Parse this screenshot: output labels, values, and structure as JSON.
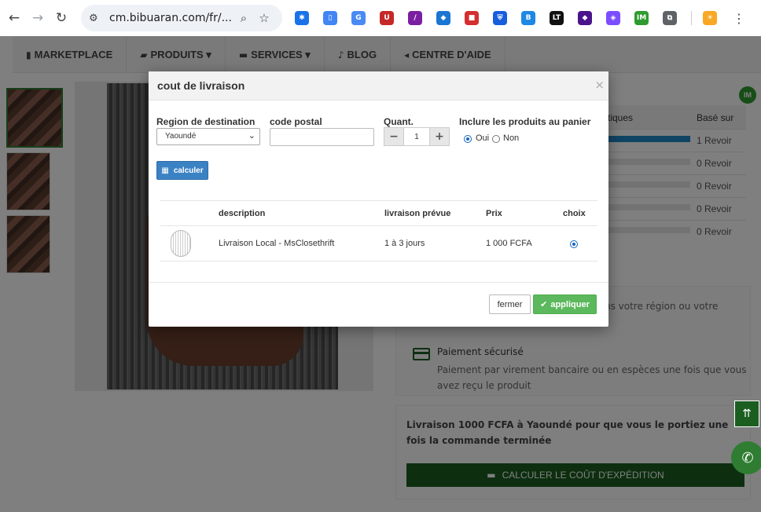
{
  "browser": {
    "url": "cm.bibuaran.com/fr/...",
    "back_icon": "←",
    "forward_icon": "→",
    "reload_icon": "↻",
    "tune_icon": "⚙",
    "zoom_icon": "⌕",
    "star_icon": "☆",
    "kebab_icon": "⋮",
    "extensions": [
      {
        "name": "ext-snowflake-icon",
        "color": "#1a73e8",
        "glyph": "✱"
      },
      {
        "name": "ext-doc-icon",
        "color": "#4285f4",
        "glyph": "▯"
      },
      {
        "name": "ext-translate-icon",
        "color": "#4a8af4",
        "glyph": "G"
      },
      {
        "name": "ext-ublock-icon",
        "color": "#c62828",
        "glyph": "U"
      },
      {
        "name": "ext-feather-icon",
        "color": "#7b1fa2",
        "glyph": "/"
      },
      {
        "name": "ext-tag-icon",
        "color": "#1976d2",
        "glyph": "◆"
      },
      {
        "name": "ext-gift-icon",
        "color": "#d32f2f",
        "glyph": "■"
      },
      {
        "name": "ext-bitwarden-icon",
        "color": "#175ddc",
        "glyph": "⛨"
      },
      {
        "name": "ext-b-icon",
        "color": "#1e88e5",
        "glyph": "B"
      },
      {
        "name": "ext-lt-icon",
        "color": "#111111",
        "glyph": "LT"
      },
      {
        "name": "ext-diamond-icon",
        "color": "#4a148c",
        "glyph": "◆"
      },
      {
        "name": "ext-puzzle-color-icon",
        "color": "#7c4dff",
        "glyph": "◈"
      },
      {
        "name": "ext-im-icon",
        "color": "#2e9b2e",
        "glyph": "IM"
      },
      {
        "name": "extensions-puzzle-icon",
        "color": "#5f6368",
        "glyph": "⧉"
      },
      {
        "name": "ext-sun-icon",
        "color": "#f9a825",
        "glyph": "☀"
      }
    ]
  },
  "nav": {
    "items": [
      {
        "icon": "▮",
        "label": "MARKETPLACE"
      },
      {
        "icon": "▰",
        "label": "PRODUITS ▾"
      },
      {
        "icon": "▬",
        "label": "SERVICES ▾"
      },
      {
        "icon": "♪",
        "label": "BLOG"
      },
      {
        "icon": "◂",
        "label": "CENTRE D'AIDE"
      }
    ]
  },
  "ratings": {
    "col_stats": "tiques",
    "col_base": "Basé sur",
    "rows": [
      {
        "fill": 1.0,
        "label": "1 Revoir"
      },
      {
        "fill": 0.0,
        "label": "0 Revoir"
      },
      {
        "fill": 0.0,
        "label": "0 Revoir"
      },
      {
        "fill": 0.0,
        "label": "0 Revoir"
      },
      {
        "fill": 0.0,
        "label": "0 Revoir"
      }
    ]
  },
  "info": {
    "delivery_line": "dans votre région ou votre",
    "payment_title": "Paiement sécurisé",
    "payment_desc": "Paiement par virement bancaire ou en espèces une fois que vous avez reçu le produit"
  },
  "shipping": {
    "text": "Livraison 1000 FCFA à Yaoundé pour que vous le portiez une fois la commande terminée",
    "button_icon": "▬",
    "button_label": "CALCULER LE COÛT D'EXPÉDITION"
  },
  "floating": {
    "scrolltop_icon": "⇈",
    "whatsapp_icon": "✆",
    "im_badge": "IM"
  },
  "modal": {
    "title": "cout de livraison",
    "close_icon": "×",
    "region_label": "Region de destination",
    "region_value": "Yaoundé",
    "postal_label": "code postal",
    "postal_value": "",
    "qty_label": "Quant.",
    "qty_minus": "−",
    "qty_value": "1",
    "qty_plus": "+",
    "include_label": "Inclure les produits au panier",
    "oui": "Oui",
    "non": "Non",
    "include_selected": "Oui",
    "calc_icon": "▦",
    "calc_label": "calculer",
    "table": {
      "headers": [
        "description",
        "livraison prévue",
        "Prix",
        "choix"
      ],
      "rows": [
        {
          "description": "Livraison Local - MsClosethrift",
          "eta": "1 à 3 jours",
          "price": "1 000 FCFA",
          "selected": true
        }
      ]
    },
    "close_label": "fermer",
    "apply_icon": "✔",
    "apply_label": "appliquer"
  }
}
